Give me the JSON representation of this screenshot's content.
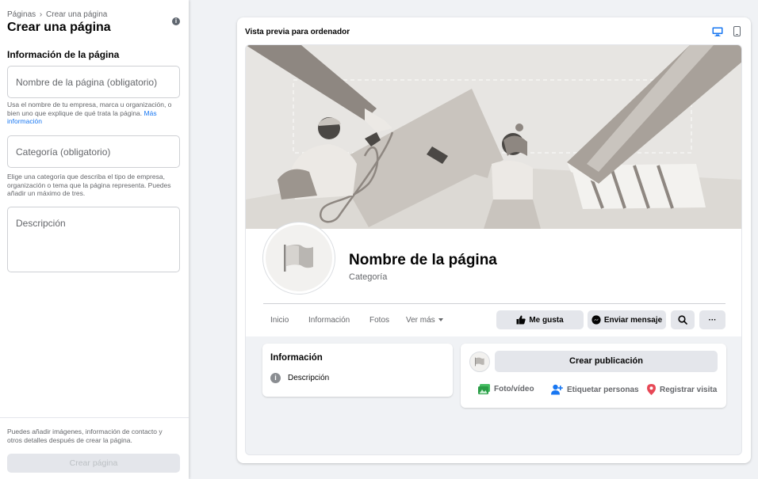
{
  "left_panel": {
    "breadcrumb": {
      "parent": "Páginas",
      "separator": "›",
      "current": "Crear una página"
    },
    "title": "Crear una página",
    "info_icon": "i",
    "section_title": "Información de la página",
    "name_field": {
      "placeholder": "Nombre de la página (obligatorio)"
    },
    "name_help": "Usa el nombre de tu empresa, marca u organización, o bien uno que explique de qué trata la página.",
    "name_help_link": "Más información",
    "category_field": {
      "placeholder": "Categoría (obligatorio)"
    },
    "category_help": "Elige una categoría que describa el tipo de empresa, organización o tema que la página representa. Puedes añadir un máximo de tres.",
    "description_field": {
      "placeholder": "Descripción"
    },
    "footer_text": "Puedes añadir imágenes, información de contacto y otros detalles después de crear la página.",
    "create_button": "Crear página"
  },
  "preview": {
    "label": "Vista previa para ordenador",
    "icons": {
      "desktop": "desktop-icon",
      "mobile": "mobile-icon"
    },
    "page_name": "Nombre de la página",
    "category": "Categoría",
    "tabs": [
      "Inicio",
      "Información",
      "Fotos",
      "Ver más"
    ],
    "actions": {
      "like": "Me gusta",
      "message": "Enviar mensaje",
      "more": "···"
    },
    "info_card": {
      "title": "Información",
      "icon": "i",
      "description": "Descripción"
    },
    "post_card": {
      "create_post": "Crear publicación",
      "actions": [
        "Foto/vídeo",
        "Etiquetar personas",
        "Registrar visita"
      ]
    },
    "colors": {
      "accent": "#1877f2",
      "cover_bg": "#e7e5e2"
    }
  }
}
